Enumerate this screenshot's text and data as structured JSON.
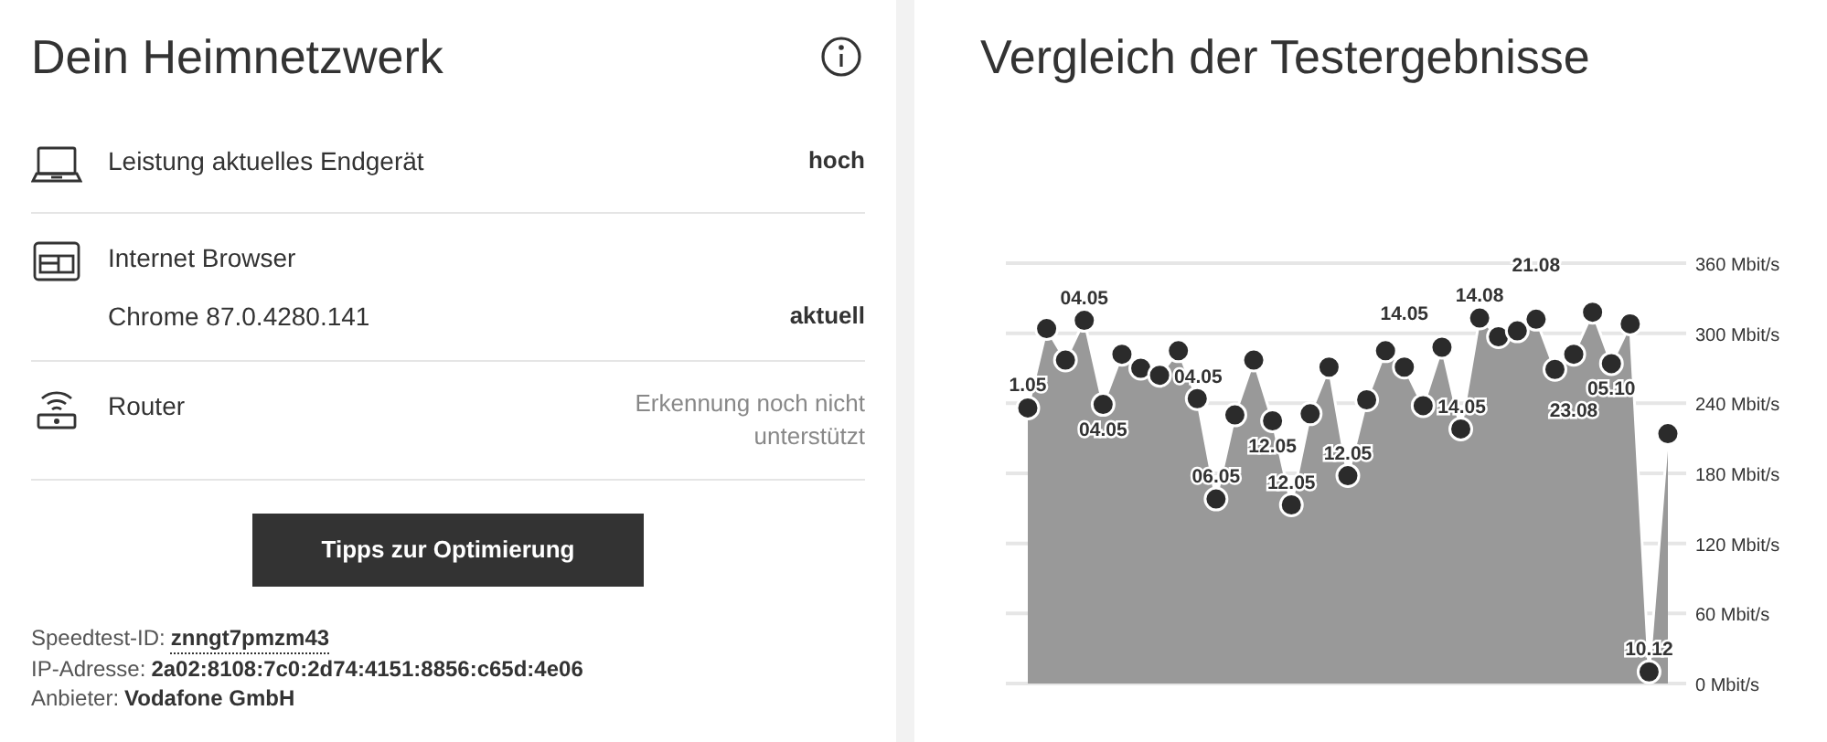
{
  "home_network": {
    "title": "Dein Heimnetzwerk",
    "rows": [
      {
        "kind": "laptop",
        "label": "Leistung aktuelles Endgerät",
        "value": "hoch",
        "highlighted": true
      },
      {
        "kind": "browser",
        "label": "Internet Browser",
        "detail": "Chrome 87.0.4280.141",
        "value": "aktuell",
        "highlighted": true
      },
      {
        "kind": "router",
        "label": "Router",
        "value": "Erkennung noch nicht unterstützt",
        "highlighted": false
      }
    ],
    "button": "Tipps zur Optimierung",
    "info": [
      {
        "label": "Speedtest-ID:",
        "value": "znngt7pmzm43",
        "link": true
      },
      {
        "label": "IP-Adresse:",
        "value": "2a02:8108:7c0:2d74:4151:8856:c65d:4e06",
        "link": false
      },
      {
        "label": "Anbieter:",
        "value": "Vodafone GmbH",
        "link": false
      }
    ]
  },
  "comparison": {
    "title": "Vergleich der Testergebnisse",
    "chart_data": {
      "type": "area",
      "ylim": [
        0,
        360
      ],
      "grid": true,
      "yticks": [
        {
          "value": 0,
          "label": "0 Mbit/s"
        },
        {
          "value": 60,
          "label": "60 Mbit/s"
        },
        {
          "value": 120,
          "label": "120 Mbit/s"
        },
        {
          "value": 180,
          "label": "180 Mbit/s"
        },
        {
          "value": 240,
          "label": "240 Mbit/s"
        },
        {
          "value": 300,
          "label": "300 Mbit/s"
        },
        {
          "value": 360,
          "label": "360 Mbit/s"
        }
      ],
      "series": [
        {
          "color": "#999999",
          "values": [
            236,
            304,
            277,
            311,
            239,
            282,
            270,
            264,
            285,
            244,
            158,
            230,
            277,
            225,
            153,
            231,
            271,
            178,
            243,
            285,
            271,
            238,
            288,
            218,
            313,
            297,
            302,
            312,
            269,
            282,
            318,
            274,
            308,
            10,
            214
          ]
        }
      ],
      "data_labels": "value_labels",
      "value_labels": [
        "1.05",
        null,
        null,
        "04.05",
        "04.05",
        null,
        null,
        "04.05",
        null,
        null,
        "06.05",
        null,
        null,
        "12.05",
        "12.05",
        null,
        null,
        "12.05",
        null,
        null,
        "14.05",
        "14.05",
        null,
        null,
        "14.08",
        null,
        null,
        "21.08",
        null,
        "23.08",
        null,
        "05.10",
        null,
        "10.12",
        null
      ]
    }
  }
}
